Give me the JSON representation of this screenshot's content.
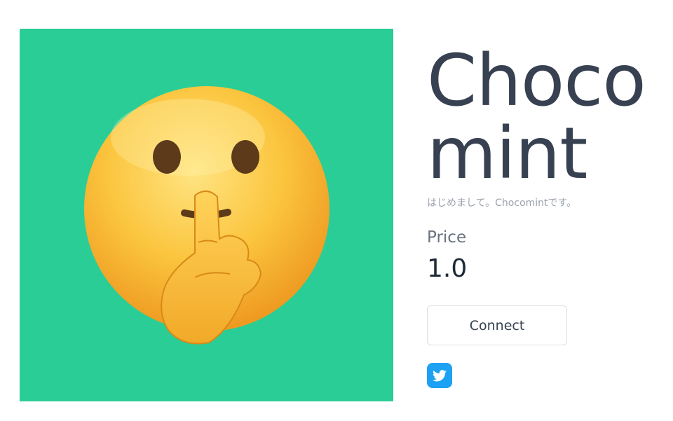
{
  "product": {
    "title": "Chocomint",
    "description": "はじめまして。Chocomintです。",
    "image_icon": "shushing-face-emoji-icon",
    "image_background": "#2ACD96"
  },
  "pricing": {
    "label": "Price",
    "value": "1.0"
  },
  "actions": {
    "connect_label": "Connect"
  },
  "social": {
    "twitter_icon": "twitter-bird-icon",
    "twitter_color": "#1DA1F2"
  },
  "colors": {
    "title_text": "#374151",
    "muted_text": "#9CA3AF",
    "label_text": "#6B7280",
    "value_text": "#1F2937",
    "button_text": "#374151"
  }
}
